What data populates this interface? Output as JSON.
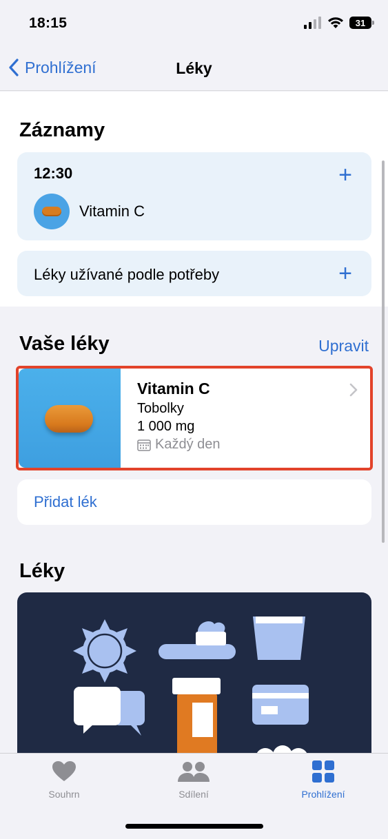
{
  "status_bar": {
    "time": "18:15",
    "battery": "31"
  },
  "nav": {
    "back_label": "Prohlížení",
    "title": "Léky"
  },
  "records": {
    "title": "Záznamy",
    "scheduled": {
      "time": "12:30",
      "med_name": "Vitamin C"
    },
    "as_needed_label": "Léky užívané podle potřeby"
  },
  "your_meds": {
    "title": "Vaše léky",
    "edit_label": "Upravit",
    "items": [
      {
        "name": "Vitamin C",
        "form": "Tobolky",
        "dose": "1 000 mg",
        "schedule": "Každý den"
      }
    ],
    "add_label": "Přidat lék"
  },
  "meds_section": {
    "title": "Léky"
  },
  "tabbar": {
    "items": [
      {
        "label": "Souhrn",
        "icon": "heart-icon"
      },
      {
        "label": "Sdílení",
        "icon": "people-icon"
      },
      {
        "label": "Prohlížení",
        "icon": "grid-icon",
        "active": true
      }
    ]
  },
  "colors": {
    "accent": "#2f6fd1",
    "highlight_border": "#e2432b",
    "pill": "#d87a1d",
    "thumb_blue": "#4aa3e5"
  }
}
